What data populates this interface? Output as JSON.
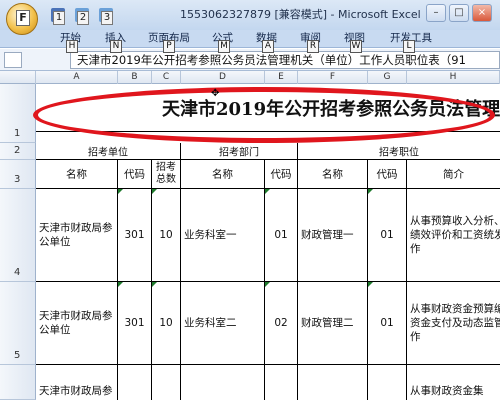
{
  "window": {
    "title": "1553062327879 [兼容模式] - Microsoft Excel",
    "office_button_key": "F",
    "controls": [
      "–",
      "□",
      "×"
    ]
  },
  "qat": {
    "keys": [
      "1",
      "2",
      "3"
    ]
  },
  "ribbon": {
    "tabs": [
      {
        "label": "开始",
        "key": "H"
      },
      {
        "label": "插入",
        "key": "N"
      },
      {
        "label": "页面布局",
        "key": "P"
      },
      {
        "label": "公式",
        "key": "M"
      },
      {
        "label": "数据",
        "key": "A"
      },
      {
        "label": "审阅",
        "key": "R"
      },
      {
        "label": "视图",
        "key": "W"
      },
      {
        "label": "开发工具",
        "key": "L"
      }
    ]
  },
  "formula_bar": {
    "content": "天津市2019年公开招考参照公务员法管理机关（单位）工作人员职位表（91"
  },
  "grid": {
    "columns": [
      "A",
      "B",
      "C",
      "D",
      "E",
      "F",
      "G",
      "H"
    ],
    "rows": [
      "1",
      "2",
      "3",
      "4",
      "5"
    ],
    "title": "天津市2019年公开招考参照公务员法管理",
    "group_headers": [
      "招考单位",
      "招考部门",
      "招考职位"
    ],
    "headers": [
      "名称",
      "代码",
      "招考总数",
      "名称",
      "代码",
      "名称",
      "代码",
      "简介"
    ],
    "data_rows": [
      {
        "unit_name": "天津市财政局参公单位",
        "unit_code": "301",
        "total": "10",
        "dept_name": "业务科室一",
        "dept_code": "01",
        "pos_name": "财政管理一",
        "pos_code": "01",
        "intro": "从事预算收入分析、预算绩效评价和工资统发等工作"
      },
      {
        "unit_name": "天津市财政局参公单位",
        "unit_code": "301",
        "total": "10",
        "dept_name": "业务科室二",
        "dept_code": "02",
        "pos_name": "财政管理二",
        "pos_code": "01",
        "intro": "从事财政资金预算编制、资金支付及动态监管等工作"
      }
    ],
    "partial_row": {
      "unit_name": "天津市财政局参",
      "intro": "从事财政资金集"
    }
  },
  "colors": {
    "highlight": "#e0161d",
    "ribbon": "#c8daf1"
  }
}
